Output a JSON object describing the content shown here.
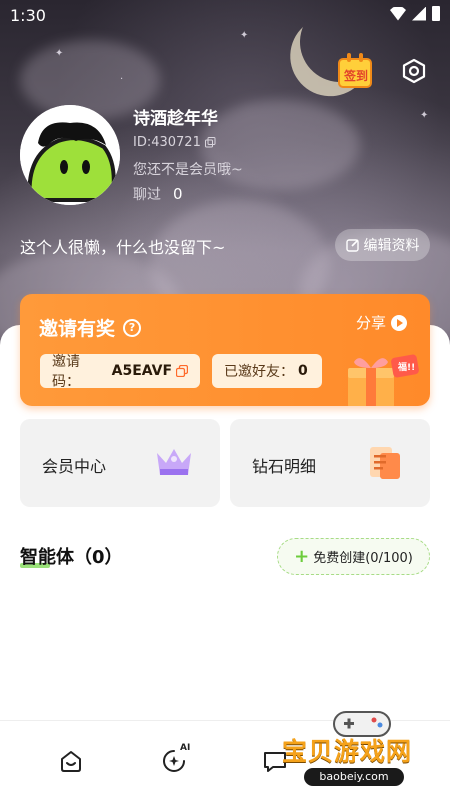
{
  "status_bar": {
    "time": "1:30"
  },
  "header": {
    "signin_label": "签到"
  },
  "profile": {
    "name": "诗酒趁年华",
    "id_text": "ID:430721",
    "vip_text": "您还不是会员哦~",
    "chat_label": "聊过",
    "chat_value": "0",
    "bio": "这个人很懒，什么也没留下~",
    "edit_label": "编辑资料"
  },
  "invite": {
    "title": "邀请有奖",
    "share_label": "分享",
    "code_label": "邀请码：",
    "code_value": "A5EAVF",
    "invited_label": "已邀好友：",
    "invited_value": "0",
    "gift_tag": "福!!"
  },
  "cards": [
    {
      "label": "会员中心"
    },
    {
      "label": "钻石明细"
    }
  ],
  "agents": {
    "title": "智能体（0）",
    "create_label": "免费创建(0/100)"
  },
  "nav": {
    "ai_badge": "AI"
  },
  "watermark": {
    "title": "宝贝游戏网",
    "url": "baobeiy.com"
  },
  "colors": {
    "accent_orange": "#ff8a2a",
    "accent_green": "#6ccc3c"
  }
}
